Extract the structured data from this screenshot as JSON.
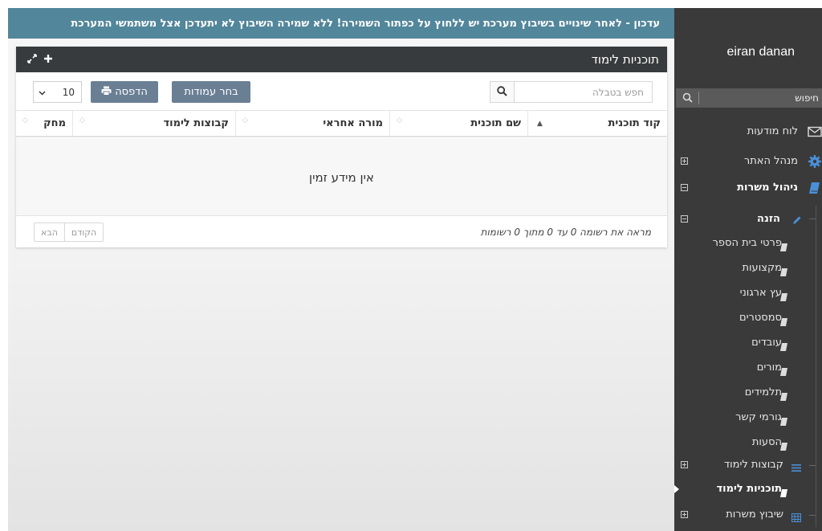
{
  "banner": {
    "text": "עדכון - לאחר שינויים בשיבוץ מערכת יש ללחוץ על כפתור השמירה! ללא שמירה השיבוץ לא יתעדכן אצל משתמשי המערכת"
  },
  "panel": {
    "title": "תוכניות לימוד",
    "search_placeholder": "חפש בטבלה",
    "choose_columns_label": "בחר עמודות",
    "print_label": "הדפסה",
    "page_size": "10",
    "columns": [
      "קוד תוכנית",
      "שם תוכנית",
      "מורה אחראי",
      "קבוצות לימוד",
      "מחק"
    ],
    "empty_text": "אין מידע זמין",
    "info_text": "מראה את רשומה 0 עד 0 מתוך 0 רשומות",
    "prev_label": "הקודם",
    "next_label": "הבא"
  },
  "sidebar": {
    "user_name": "eiran danan",
    "search_placeholder": "חיפוש",
    "items": [
      {
        "label": "לוח מודעות",
        "icon": "envelope-icon"
      },
      {
        "label": "מנהל האתר",
        "icon": "gear-icon"
      },
      {
        "label": "ניהול משרות",
        "icon": "book-icon"
      },
      {
        "label": "הזנה",
        "icon": "pencil-icon"
      },
      {
        "label": "פרטי בית הספר",
        "icon": "book-icon"
      },
      {
        "label": "מקצועות",
        "icon": "book-icon"
      },
      {
        "label": "עץ ארגוני",
        "icon": "book-icon"
      },
      {
        "label": "סמסטרים",
        "icon": "book-icon"
      },
      {
        "label": "עובדים",
        "icon": "book-icon"
      },
      {
        "label": "מורים",
        "icon": "book-icon"
      },
      {
        "label": "תלמידים",
        "icon": "book-icon"
      },
      {
        "label": "גורמי קשר",
        "icon": "book-icon"
      },
      {
        "label": "הסעות",
        "icon": "book-icon"
      },
      {
        "label": "קבוצות לימוד",
        "icon": "list-icon"
      },
      {
        "label": "תוכניות לימוד",
        "icon": "book-icon"
      },
      {
        "label": "שיבוץ משרות",
        "icon": "grid-icon"
      }
    ]
  },
  "colors": {
    "banner": "#52869b",
    "panel_header": "#383b3d",
    "button": "#6a7f94",
    "sidebar": "#3a3a3a",
    "accent_blue": "#4a90d9"
  }
}
